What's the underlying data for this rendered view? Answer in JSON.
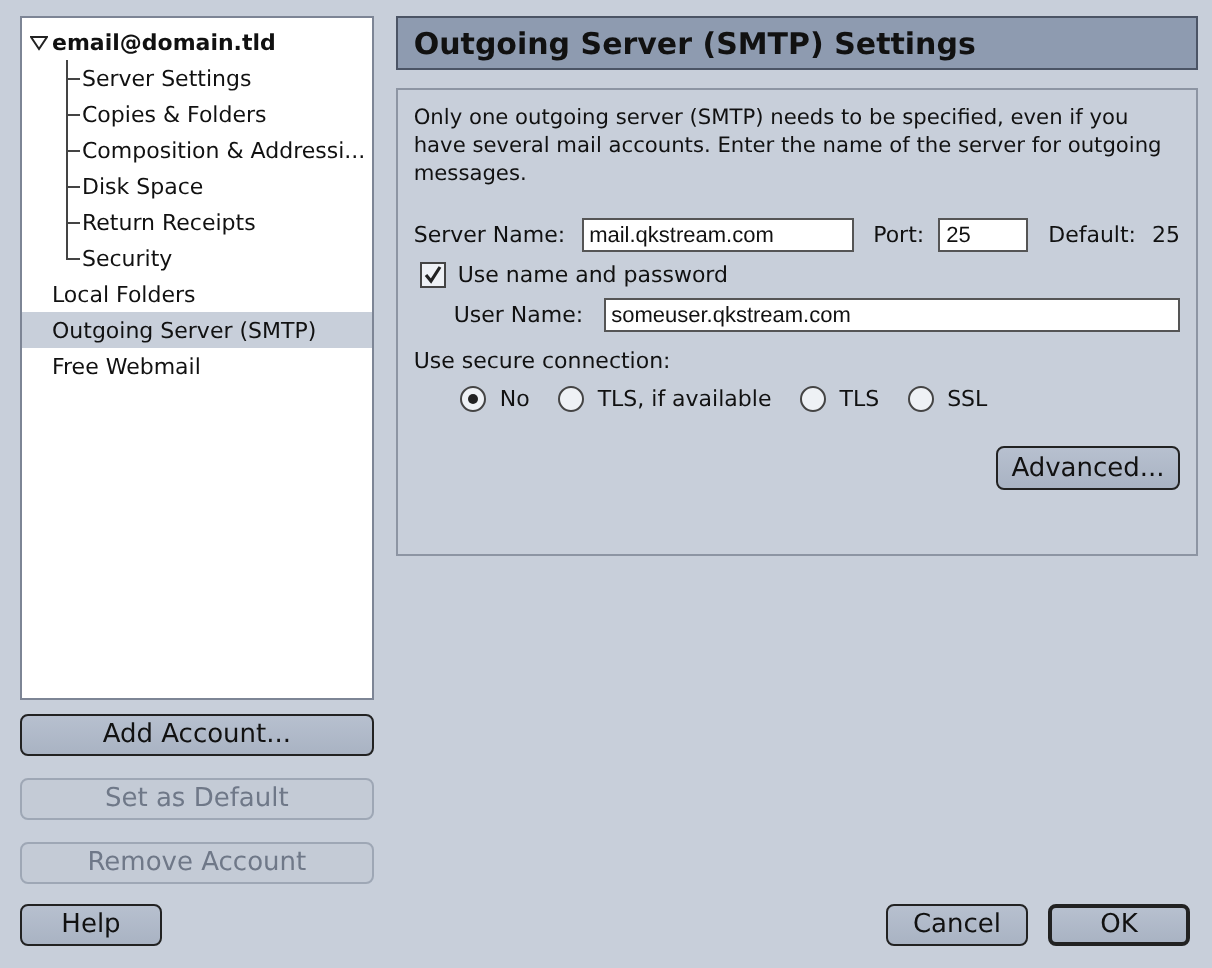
{
  "accounts": [
    {
      "label": "email@domain.tld",
      "expanded": true,
      "selected": false,
      "children": [
        {
          "label": "Server Settings",
          "selected": false
        },
        {
          "label": "Copies & Folders",
          "selected": false
        },
        {
          "label": "Composition & Addressi...",
          "selected": false
        },
        {
          "label": "Disk Space",
          "selected": false
        },
        {
          "label": "Return Receipts",
          "selected": false
        },
        {
          "label": "Security",
          "selected": false
        }
      ]
    },
    {
      "label": "Local Folders",
      "selected": false
    },
    {
      "label": "Outgoing Server (SMTP)",
      "selected": true
    },
    {
      "label": "Free Webmail",
      "selected": false
    }
  ],
  "account_buttons": [
    {
      "label": "Add Account...",
      "disabled": false
    },
    {
      "label": "Set as Default",
      "disabled": true
    },
    {
      "label": "Remove Account",
      "disabled": true
    }
  ],
  "settings": {
    "title": "Outgoing Server (SMTP) Settings",
    "description": "Only one outgoing server (SMTP) needs to be specified, even if you have several mail accounts. Enter the name of the server for outgoing messages.",
    "server_name": {
      "label": "Server Name:",
      "value": "mail.qkstream.com"
    },
    "port": {
      "label": "Port:",
      "value": "25"
    },
    "default_port": {
      "label": "Default:",
      "value": "25"
    },
    "use_name_password": {
      "label": "Use name and password",
      "checked": true
    },
    "user_name": {
      "label": "User Name:",
      "value": "someuser.qkstream.com"
    },
    "secure_label": "Use secure connection:",
    "secure_options": [
      {
        "label": "No",
        "selected": true
      },
      {
        "label": "TLS, if available",
        "selected": false
      },
      {
        "label": "TLS",
        "selected": false
      },
      {
        "label": "SSL",
        "selected": false
      }
    ],
    "advanced_button": "Advanced..."
  },
  "help_button": "Help",
  "dialog_buttons": [
    {
      "label": "Cancel",
      "default": false
    },
    {
      "label": "OK",
      "default": true
    }
  ]
}
